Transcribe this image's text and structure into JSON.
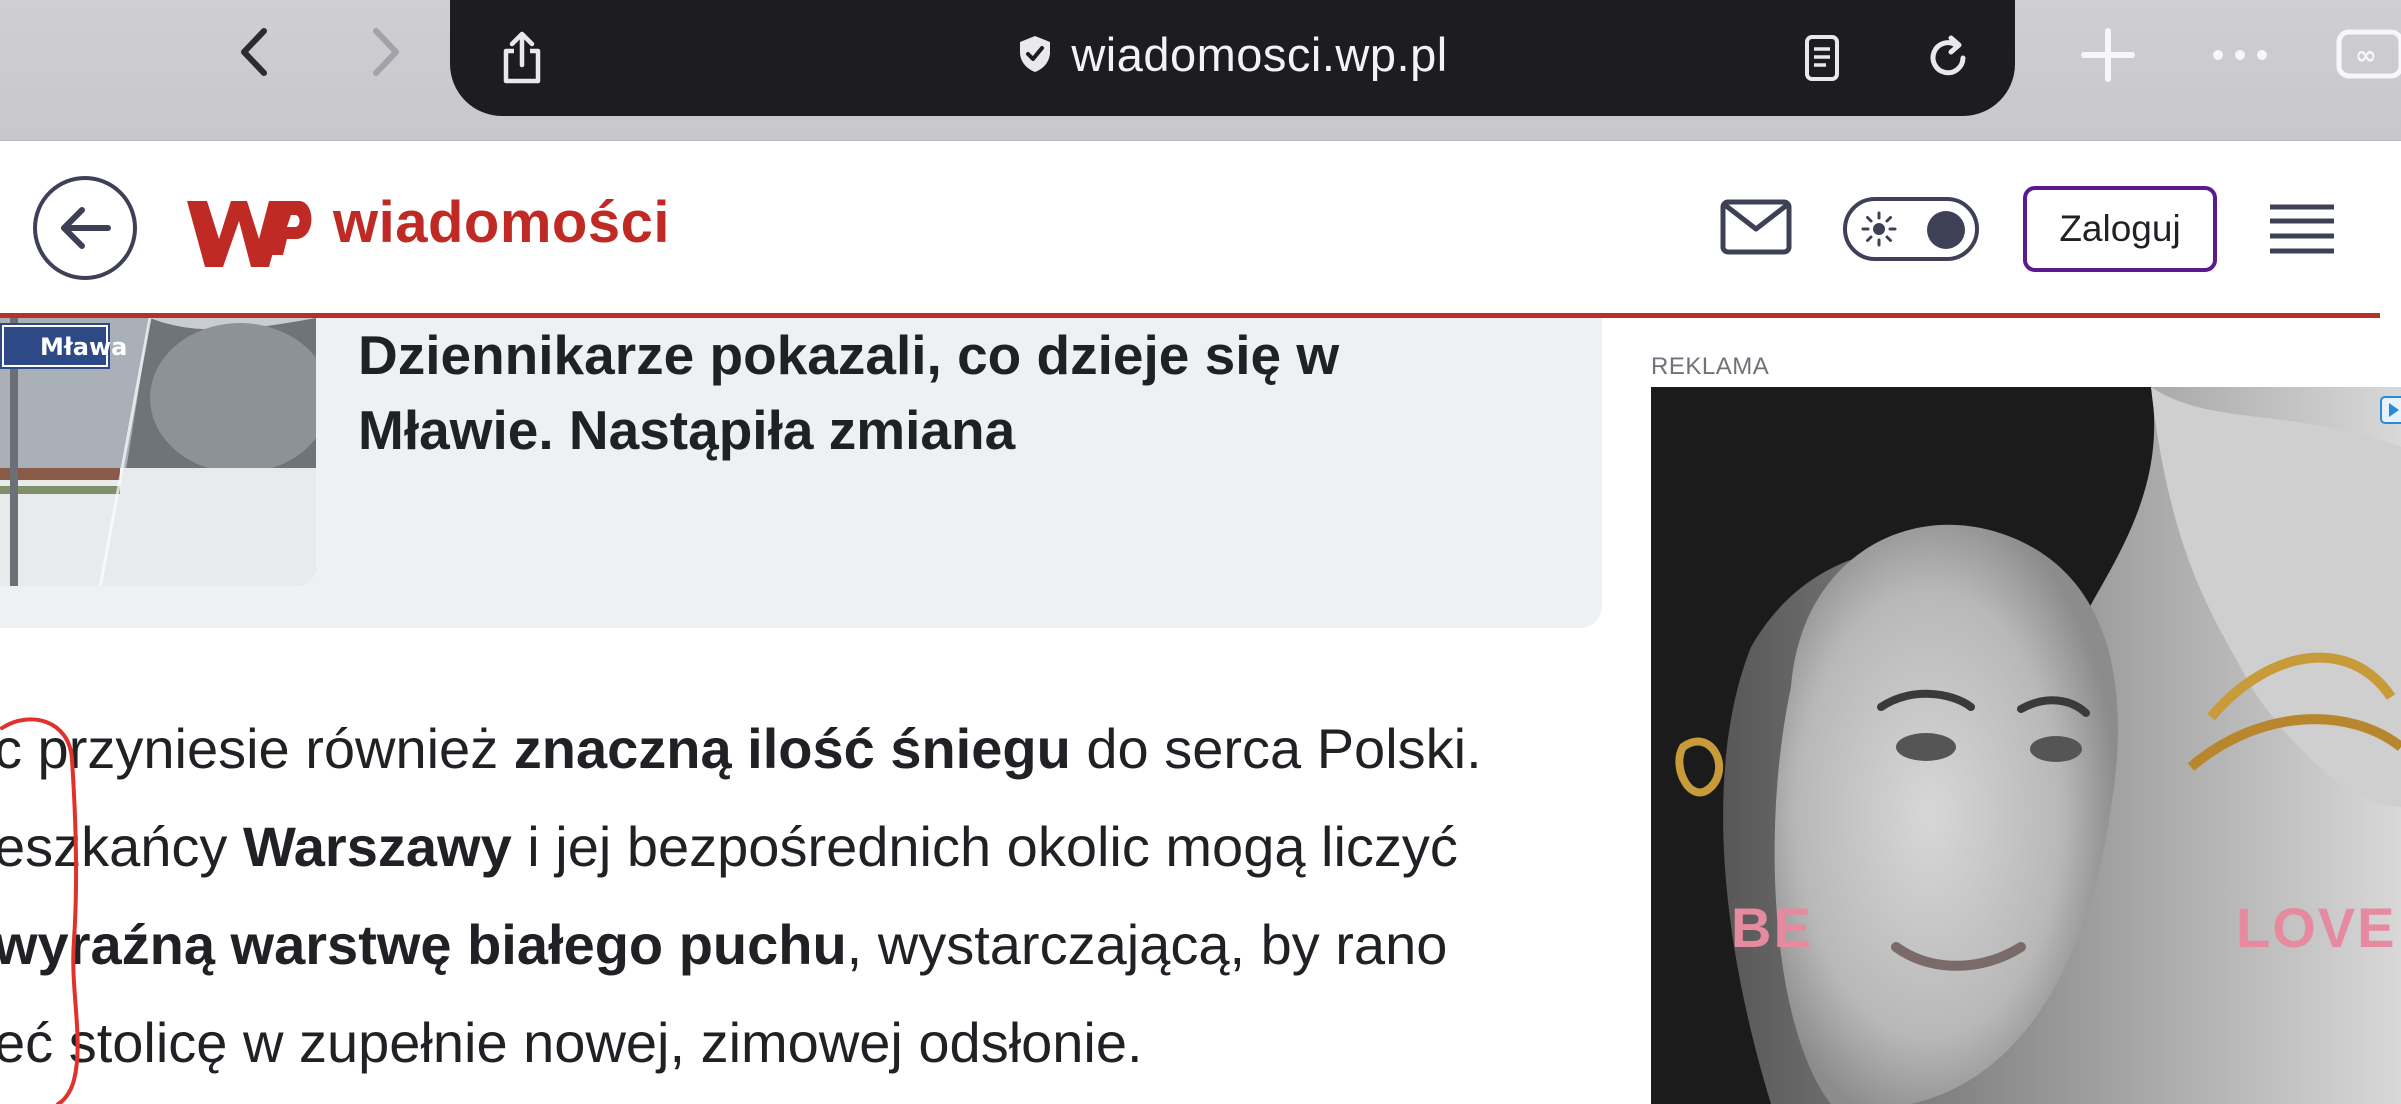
{
  "browser": {
    "url": "wiadomosci.wp.pl",
    "icons": {
      "back": "chevron-left-icon",
      "forward": "chevron-right-icon",
      "share": "share-icon",
      "secure": "shield-check-icon",
      "reader": "reader-mode-icon",
      "reload": "reload-icon",
      "new_tab": "plus-icon",
      "more": "ellipsis-icon",
      "tabs": "tabs-overview-icon"
    }
  },
  "header": {
    "logo_text": "wiadomości",
    "login_label": "Zaloguj",
    "icons": {
      "back": "arrow-left-icon",
      "logo": "wp-logo-icon",
      "mail": "mail-icon",
      "theme": "sun-icon",
      "menu": "hamburger-menu-icon"
    },
    "colors": {
      "brand_red": "#c02a24",
      "login_border": "#5b1a8e",
      "icon_gray": "#3e4155"
    }
  },
  "related": {
    "title_line1": "Dziennikarze pokazali, co dzieje się w",
    "title_line2": "Mławie. Nastąpiła zmiana",
    "thumb_sign": "Mława"
  },
  "article": {
    "lines": [
      [
        {
          "t": "c przyniesie również ",
          "b": false
        },
        {
          "t": "znaczną ilość śniegu",
          "b": true
        },
        {
          "t": " do serca Polski.",
          "b": false
        }
      ],
      [
        {
          "t": "eszkańcy ",
          "b": false
        },
        {
          "t": "Warszawy",
          "b": true
        },
        {
          "t": " i jej bezpośrednich okolic mogą liczyć",
          "b": false
        }
      ],
      [
        {
          "t": "wyraźną warstwę białego puchu",
          "b": true
        },
        {
          "t": ", wystarczającą, by rano",
          "b": false
        }
      ],
      [
        {
          "t": "eć stolicę w zupełnie nowej, zimowej odsłonie.",
          "b": false
        }
      ]
    ]
  },
  "ad": {
    "label": "REKLAMA",
    "text_left": "BE",
    "text_right": "LOVE"
  }
}
